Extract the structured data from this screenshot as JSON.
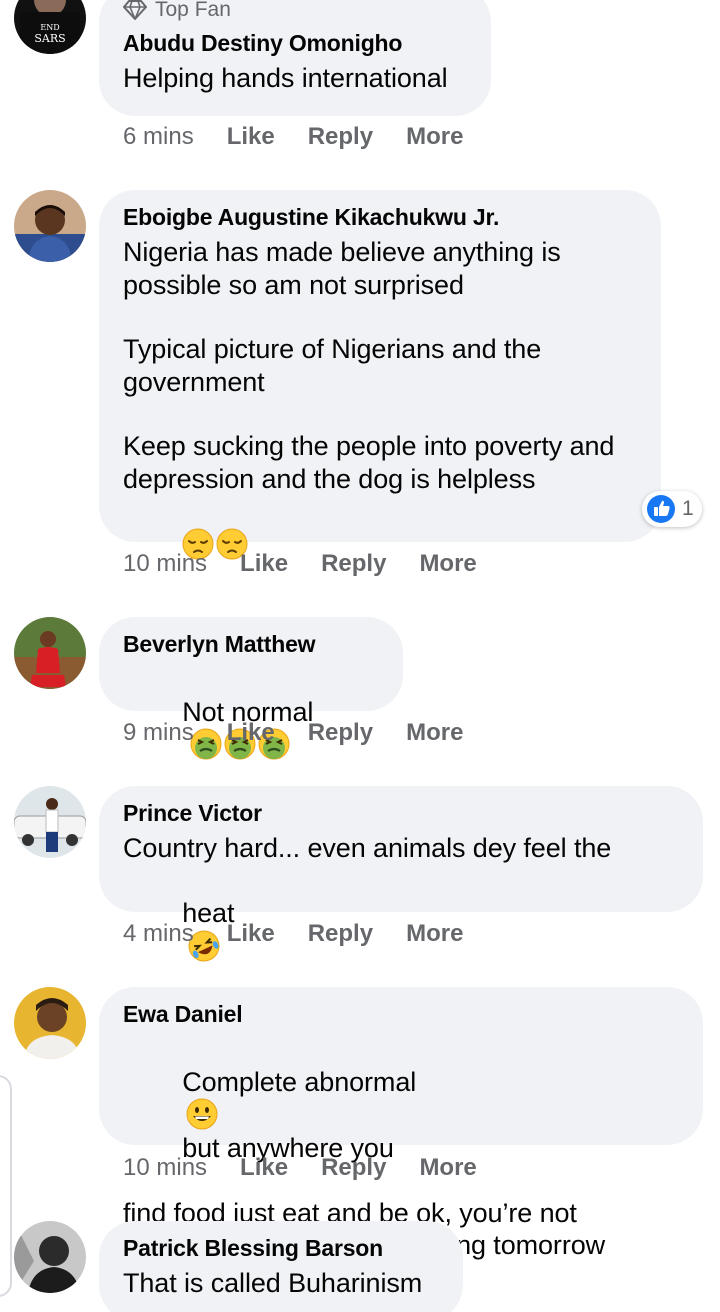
{
  "comments": [
    {
      "badge": "Top Fan",
      "author": "Abudu Destiny Omonigho",
      "lines": [
        "Helping hands international"
      ],
      "time": "6 mins",
      "actions": [
        "Like",
        "Reply",
        "More"
      ]
    },
    {
      "author": "Eboigbe Augustine Kikachukwu Jr.",
      "paragraphs": [
        "Nigeria has made believe anything is\npossible so am not surprised",
        "Typical picture of Nigerians and the\ngovernment",
        "Keep sucking the people into poverty and\ndepression and the dog is helpless"
      ],
      "emojis": [
        "pensive-face",
        "pensive-face"
      ],
      "reaction": {
        "icon": "like-reaction-icon",
        "count": "1"
      },
      "time": "10 mins",
      "actions": [
        "Like",
        "Reply",
        "More"
      ]
    },
    {
      "author": "Beverlyn Matthew",
      "text": "Not normal",
      "emojis": [
        "nauseated-face",
        "nauseated-face",
        "nauseated-face"
      ],
      "time": "9 mins",
      "actions": [
        "Like",
        "Reply",
        "More"
      ]
    },
    {
      "author": "Prince Victor",
      "line1": "Country hard... even animals dey feel the",
      "line2": "heat",
      "emojis": [
        "rolling-laughing-face"
      ],
      "time": "4 mins",
      "actions": [
        "Like",
        "Reply",
        "More"
      ]
    },
    {
      "author": "Ewa Daniel",
      "line1a": "Complete abnormal",
      "line1b": "but anywhere you",
      "line2": "find food just eat and be ok, you’re not",
      "line3": "chance to know what’s coming tomorrow",
      "emojis": [
        "grinning-face"
      ],
      "time": "10 mins",
      "actions": [
        "Like",
        "Reply",
        "More"
      ]
    },
    {
      "author": "Patrick Blessing Barson",
      "text": "That is called Buharinism"
    }
  ],
  "colors": {
    "bubble": "#f0f2f5",
    "meta_text": "#65676b",
    "like_blue": "#1877f2",
    "emoji_yellow": "#ffcc33",
    "nausea_green": "#6ab04c"
  }
}
